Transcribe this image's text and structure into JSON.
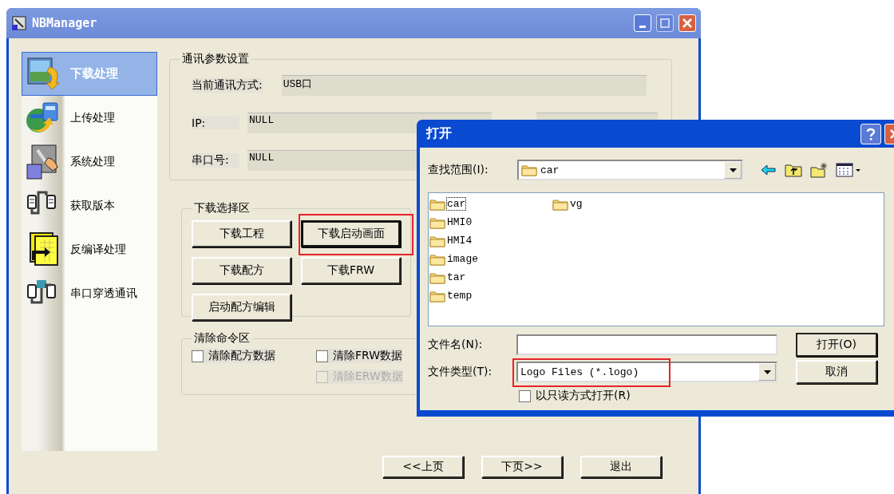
{
  "main_window": {
    "title": "NBManager",
    "sidebar": {
      "items": [
        {
          "label": "下载处理",
          "selected": true
        },
        {
          "label": "上传处理",
          "selected": false
        },
        {
          "label": "系统处理",
          "selected": false
        },
        {
          "label": "获取版本",
          "selected": false
        },
        {
          "label": "反编译处理",
          "selected": false
        },
        {
          "label": "串口穿透通讯",
          "selected": false
        }
      ]
    },
    "comm_settings": {
      "title": "通讯参数设置",
      "fields": [
        {
          "label": "当前通讯方式:",
          "value": "USB口"
        },
        {
          "label": "IP:",
          "value": "NULL"
        },
        {
          "label": "串口号:",
          "value": "NULL"
        }
      ]
    },
    "download_group": {
      "title": "下载选择区",
      "buttons": [
        {
          "label": "下载工程",
          "focused": false,
          "highlighted": false
        },
        {
          "label": "下载启动画面",
          "focused": true,
          "highlighted": true
        },
        {
          "label": "下载配方",
          "focused": false,
          "highlighted": false
        },
        {
          "label": "下载FRW",
          "focused": false,
          "highlighted": false
        },
        {
          "label": "启动配方编辑",
          "focused": false,
          "highlighted": false
        }
      ]
    },
    "clear_group": {
      "title": "清除命令区",
      "checkboxes": [
        {
          "label": "清除配方数据",
          "checked": false,
          "disabled": false
        },
        {
          "label": "清除FRW数据",
          "checked": false,
          "disabled": false
        },
        {
          "label": "清除ERW数据",
          "checked": false,
          "disabled": true
        }
      ]
    },
    "nav_buttons": [
      "<<上页",
      "下页>>",
      "退出"
    ]
  },
  "open_dialog": {
    "title": "打开",
    "look_in": {
      "label": "查找范围(I):",
      "value": "car"
    },
    "files": [
      {
        "name": "car",
        "focused": true
      },
      {
        "name": "HMI0",
        "focused": false
      },
      {
        "name": "HMI4",
        "focused": false
      },
      {
        "name": "image",
        "focused": false
      },
      {
        "name": "tar",
        "focused": false
      },
      {
        "name": "temp",
        "focused": false
      },
      {
        "name": "vg",
        "focused": false
      }
    ],
    "file_name": {
      "label": "文件名(N):"
    },
    "file_type": {
      "label": "文件类型(T):",
      "value": "Logo Files (*.logo)",
      "highlighted": true
    },
    "buttons": [
      "打开(O)",
      "取消"
    ],
    "read_only": {
      "label": "以只读方式打开(R)",
      "checked": false
    }
  }
}
